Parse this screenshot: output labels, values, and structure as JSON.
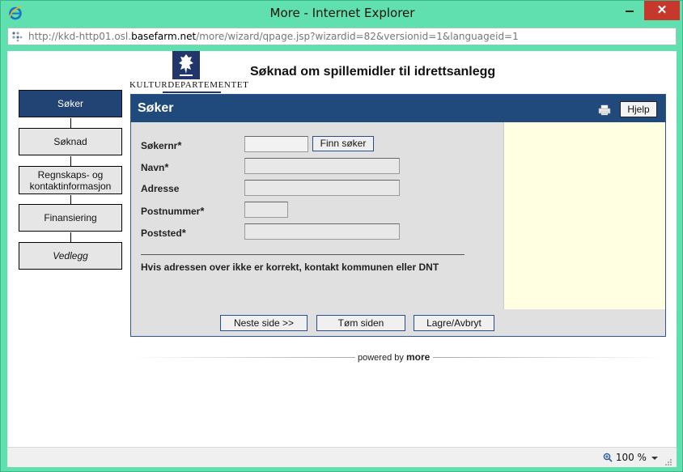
{
  "window": {
    "title": "More - Internet Explorer",
    "close_glyph": "✕"
  },
  "addressbar": {
    "url_prefix": "http://kkd-http01.osl.",
    "url_domain": "basefarm.net",
    "url_suffix": "/more/wizard/qpage.jsp?wizardid=82&versionid=1&languageid=1"
  },
  "header": {
    "logo_text": "KULTURDEPARTEMENTET",
    "app_title": "Søknad om spillemidler til idrettsanlegg"
  },
  "wizard": {
    "steps": [
      {
        "label": "Søker",
        "active": true
      },
      {
        "label": "Søknad",
        "active": false
      },
      {
        "label": "Regnskaps- og kontaktinformasjon",
        "active": false
      },
      {
        "label": "Finansiering",
        "active": false
      },
      {
        "label": "Vedlegg",
        "active": false
      }
    ]
  },
  "panel": {
    "title": "Søker",
    "help_label": "Hjelp",
    "find_button": "Finn søker",
    "fields": [
      {
        "label": "Søkernr",
        "required": true,
        "value": ""
      },
      {
        "label": "Navn",
        "required": true,
        "value": ""
      },
      {
        "label": "Adresse",
        "required": false,
        "value": ""
      },
      {
        "label": "Postnummer",
        "required": true,
        "value": ""
      },
      {
        "label": "Poststed",
        "required": true,
        "value": ""
      }
    ],
    "required_marker": "*",
    "notice": "Hvis adressen over ikke er korrekt, kontakt kommunen eller DNT",
    "buttons": {
      "next": "Neste side >>",
      "clear": "Tøm siden",
      "save": "Lagre/Avbryt"
    }
  },
  "footer": {
    "powered_by": "powered by",
    "brand": "more"
  },
  "statusbar": {
    "zoom": "100 %"
  },
  "colors": {
    "window_frame": "#5fe0ae",
    "panel_header": "#1f4a7b",
    "active_step": "#214474",
    "side_area": "#ffffe1"
  }
}
